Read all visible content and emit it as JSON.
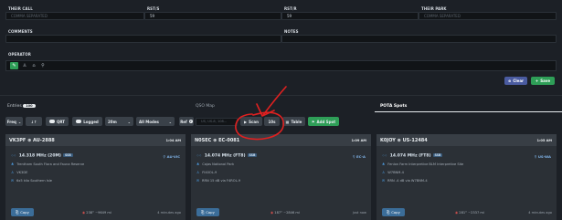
{
  "form": {
    "their_call": {
      "label": "THEIR CALL",
      "placeholder": "COMMA SEPARATED"
    },
    "rst_s": {
      "label": "RST/S",
      "value": "59"
    },
    "rst_r": {
      "label": "RST/R",
      "value": "59"
    },
    "their_park": {
      "label": "THEIR PARK",
      "placeholder": "COMMA SEPARATED"
    },
    "comments": {
      "label": "COMMENTS"
    },
    "notes": {
      "label": "NOTES"
    },
    "operator": {
      "label": "OPERATOR"
    },
    "clear_label": "Clear",
    "save_label": "Save"
  },
  "tabs": {
    "entries": "Entries",
    "entries_count": "100",
    "qso_map": "QSO Map",
    "pota_spots": "POTA Spots"
  },
  "toolbar": {
    "freq": "Freq",
    "qrt": "QRT",
    "logged": "Logged",
    "interval": "20m",
    "modes": "All Modes",
    "ref_label": "Ref",
    "ref_placeholder": "US, US-8, 108...",
    "scan": "Scan",
    "scan_interval": "10s",
    "table": "Table",
    "add_spot": "Add Spot"
  },
  "spots": [
    {
      "call": "VK3PF",
      "park": "AU-2888",
      "time": "1:04 AM",
      "freq": "14.318 MHz (20M)",
      "mode": "SSB",
      "location": "AU-VIC",
      "name": "Trentham South Flora and Fauna Reserve",
      "grid": "VK3DE",
      "info": "6x5 kilo Southern Isle",
      "bearing": "238°",
      "distance": "~9649 mi",
      "ago": "4 minutes ago"
    },
    {
      "call": "N0SEC",
      "park": "EC-0081",
      "time": "1:09 AM",
      "freq": "14.074 MHz (FT8)",
      "mode": "SSB",
      "location": "EC-A",
      "name": "Cajas National Park",
      "grid": "FI40OL-9",
      "info": "RRN 15 dB via F4ROL-9",
      "bearing": "187°",
      "distance": "~2846 mi",
      "ago": "just now"
    },
    {
      "call": "K0JOY",
      "park": "US-12484",
      "time": "1:05 AM",
      "freq": "14.074 MHz (FT8)",
      "mode": "SSB",
      "location": "US-WA",
      "name": "Fenlon Farm Interpretive BLM Interpretive Site",
      "grid": "W7BNM-4",
      "info": "RRN -4 dB via W7BNM-4",
      "bearing": "281°",
      "distance": "~2337 mi",
      "ago": "4 minutes ago"
    }
  ],
  "copy_label": "Copy",
  "colors": {
    "bg": "#1c2026",
    "accent_blue": "#3b6d99",
    "save_green": "#2e9e57",
    "annotation_red": "#e02020"
  }
}
